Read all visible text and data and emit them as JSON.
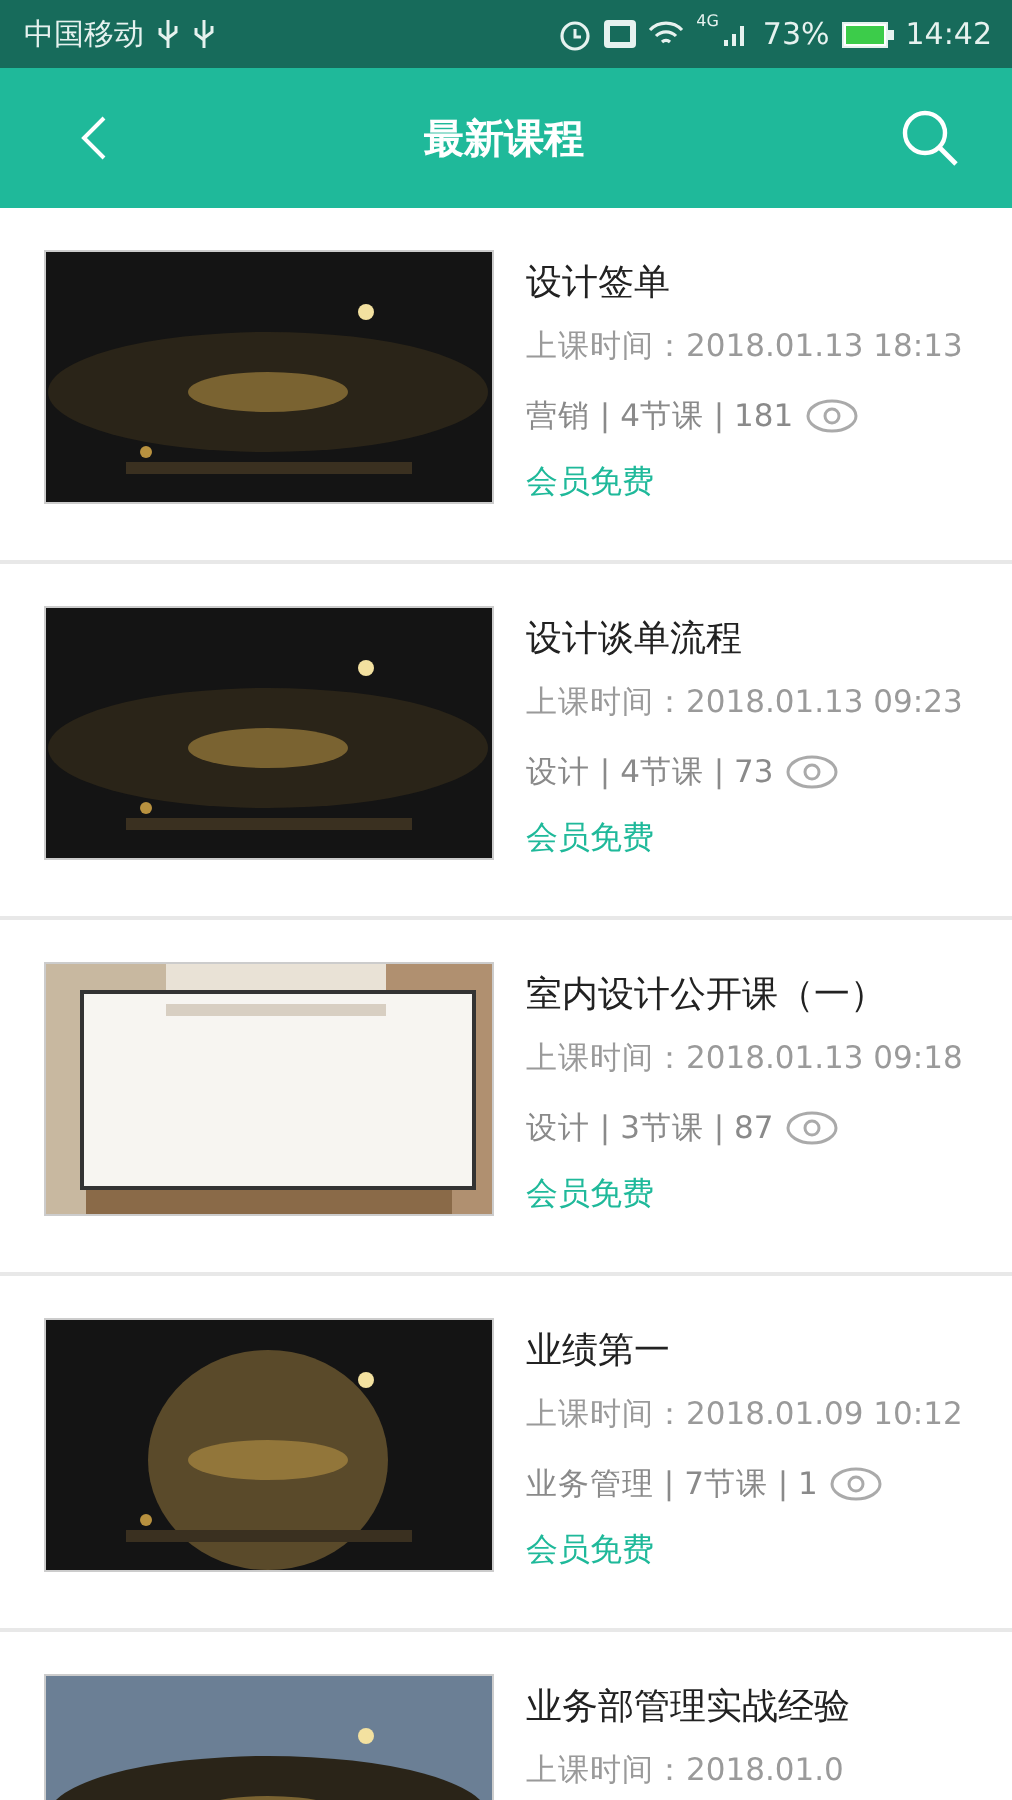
{
  "status_bar": {
    "carrier": "中国移动",
    "network": "4G",
    "battery": "73%",
    "time": "14:42"
  },
  "header": {
    "title": "最新课程"
  },
  "courses": [
    {
      "title": "设计签单",
      "time": "上课时间：2018.01.13 18:13",
      "meta": "营销 | 4节课 | 181",
      "badge": "会员免费"
    },
    {
      "title": "设计谈单流程",
      "time": "上课时间：2018.01.13 09:23",
      "meta": "设计 | 4节课 | 73",
      "badge": "会员免费"
    },
    {
      "title": "室内设计公开课（一）",
      "time": "上课时间：2018.01.13 09:18",
      "meta": "设计 | 3节课 | 87",
      "badge": "会员免费"
    },
    {
      "title": "业绩第一",
      "time": "上课时间：2018.01.09 10:12",
      "meta": "业务管理 | 7节课 | 1",
      "badge": "会员免费"
    },
    {
      "title": "业务部管理实战经验",
      "time": "上课时间：2018.01.0"
    }
  ]
}
